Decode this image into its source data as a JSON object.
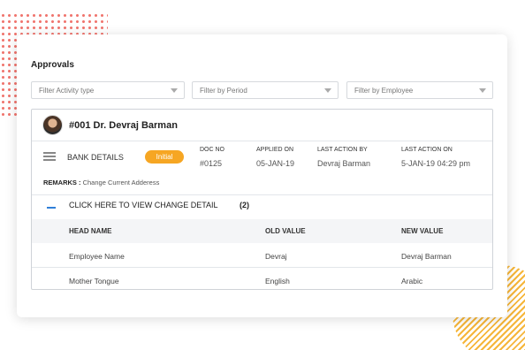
{
  "approvals": {
    "title": "Approvals",
    "filters": [
      {
        "placeholder": "Filter Activity type"
      },
      {
        "placeholder": "Filter by Period"
      },
      {
        "placeholder": "Filter by Employee"
      }
    ]
  },
  "request": {
    "employee": "#001 Dr. Devraj Barman",
    "section": "BANK DETAILS",
    "status": "Initial",
    "columns": [
      {
        "label": "DOC NO",
        "value": "#0125"
      },
      {
        "label": "APPLIED ON",
        "value": "05-JAN-19"
      },
      {
        "label": "LAST ACTION BY",
        "value": "Devraj Barman"
      },
      {
        "label": "LAST ACTION ON",
        "value": "5-JAN-19 04:29 pm"
      }
    ],
    "remarks_label": "REMARKS :",
    "remarks_value": "Change Current Adderess",
    "toggle_label": "CLICK HERE TO VIEW CHANGE DETAIL",
    "change_count": "(2)"
  },
  "changes": {
    "headers": [
      "HEAD NAME",
      "OLD VALUE",
      "NEW VALUE"
    ],
    "rows": [
      [
        "Employee Name",
        "Devraj",
        "Devraj Barman"
      ],
      [
        "Mother Tongue",
        "English",
        "Arabic"
      ]
    ]
  },
  "colors": {
    "badge": "#f6a623",
    "accent": "#2f7fd8",
    "dots": "#f0766f",
    "stripes": "#f6b63a"
  }
}
